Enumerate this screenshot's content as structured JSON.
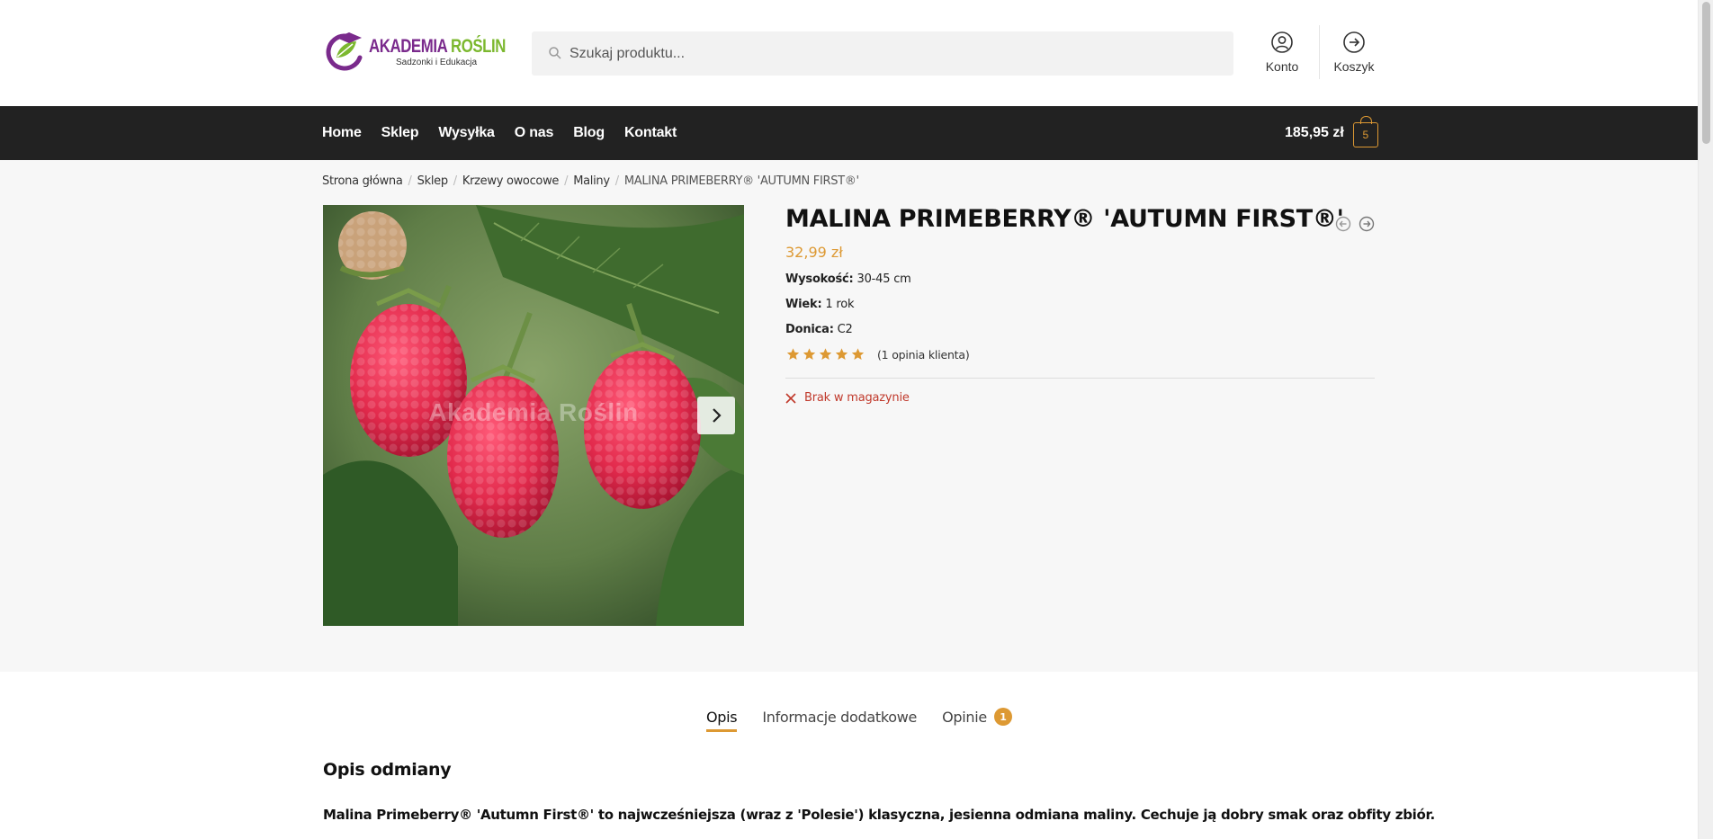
{
  "header": {
    "logo": {
      "name_part1": "AKADEMIA ",
      "name_part2": "ROŚLIN",
      "tagline": "Sadzonki i Edukacja"
    },
    "search": {
      "placeholder": "Szukaj produktu..."
    },
    "account_label": "Konto",
    "cart_link_label": "Koszyk"
  },
  "nav": {
    "items": [
      "Home",
      "Sklep",
      "Wysyłka",
      "O nas",
      "Blog",
      "Kontakt"
    ],
    "cart_total": "185,95 zł",
    "cart_count": "5"
  },
  "breadcrumb": [
    "Strona główna",
    "Sklep",
    "Krzewy owocowe",
    "Maliny",
    "MALINA PRIMEBERRY® 'AUTUMN FIRST®'"
  ],
  "product": {
    "title": "MALINA PRIMEBERRY® 'AUTUMN FIRST®'",
    "price": "32,99 zł",
    "attributes": [
      {
        "label": "Wysokość:",
        "value": " 30-45 cm"
      },
      {
        "label": "Wiek:",
        "value": " 1 rok"
      },
      {
        "label": "Donica:",
        "value": " C2"
      }
    ],
    "rating": 5,
    "review_text": "(1 opinia klienta)",
    "stock_status": "Brak w magazynie",
    "image_watermark": "Akademia Roślin"
  },
  "tabs": {
    "items": [
      "Opis",
      "Informacje dodatkowe",
      "Opinie"
    ],
    "reviews_count": "1",
    "active": "Opis"
  },
  "description": {
    "heading": "Opis odmiany",
    "lead": "Malina Primeberry® 'Autumn First®' to najwcześniejsza (wraz z 'Polesie') klasyczna, jesienna odmiana maliny. Cechuje ją dobry smak oraz obfity zbiór."
  },
  "colors": {
    "accent": "#dd9933",
    "navbar": "#222222",
    "stock_out": "#c0392b",
    "logo_purple": "#7a2a8c",
    "logo_green": "#7cb82f"
  }
}
